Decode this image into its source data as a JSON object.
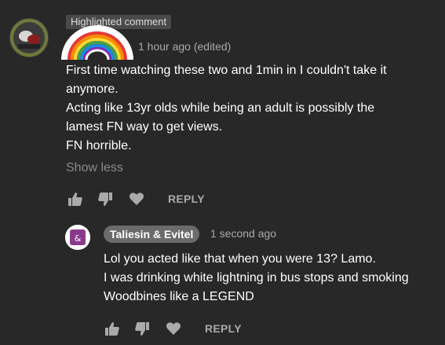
{
  "main_comment": {
    "badge": "Highlighted comment",
    "timestamp": "1 hour ago (edited)",
    "lines": [
      "First time watching these two and 1min in I couldn't take it anymore.",
      "Acting like 13yr olds while being an adult is possibly the lamest FN way to get views.",
      "FN horrible."
    ],
    "show_less": "Show less",
    "reply_label": "REPLY"
  },
  "reply_comment": {
    "author": "Taliesin & Evitel",
    "timestamp": "1 second ago",
    "lines": [
      "Lol you acted like that when you were 13? Lamo.",
      "I was drinking white lightning in bus stops and smoking Woodbines like a LEGEND"
    ],
    "reply_label": "REPLY"
  },
  "icons": [
    "thumbs-up-icon",
    "thumbs-down-icon",
    "heart-icon",
    "rainbow-sticker",
    "avatar"
  ],
  "colors": {
    "background": "#282828",
    "text": "#ffffff",
    "secondary_text": "#aaaaaa",
    "badge_bg": "#4a4a4a",
    "author_pill_bg": "#6b6b6b"
  }
}
